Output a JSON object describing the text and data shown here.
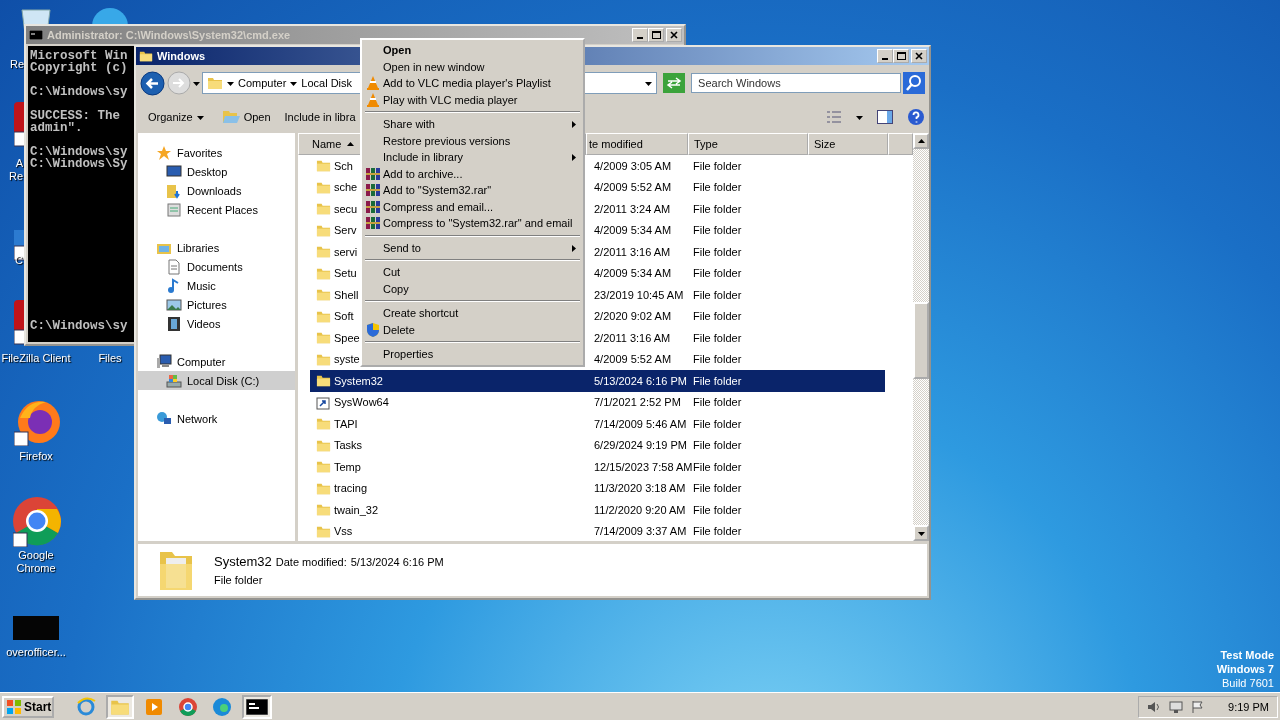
{
  "desktop_icons": [
    {
      "kind": "recycle-bin",
      "lines": [
        "Re"
      ]
    },
    {
      "kind": "blue-app"
    },
    {
      "kind": "red-app",
      "lines": [
        "A",
        "Re"
      ]
    },
    {
      "kind": "blue-shortcut",
      "lines": [
        "C"
      ]
    },
    {
      "kind": "red-app",
      "lines": [
        "FileZilla Client"
      ]
    },
    {
      "lines": [
        "Files"
      ]
    },
    {
      "kind": "firefox",
      "lines": [
        "Firefox"
      ]
    },
    {
      "kind": "chrome",
      "lines": [
        "Google",
        "Chrome"
      ]
    },
    {
      "kind": "black-file",
      "lines": [
        "overofficer..."
      ]
    }
  ],
  "cmd_window": {
    "title": "Administrator: C:\\Windows\\System32\\cmd.exe",
    "active": false,
    "output": [
      {
        "text": "Microsoft Win",
        "gap_before": false
      },
      {
        "text": "Copyright (c)",
        "gap_before": false
      },
      {
        "text": "C:\\Windows\\sy",
        "gap_before": true
      },
      {
        "text": "SUCCESS: The",
        "gap_before": true
      },
      {
        "text": "admin\".",
        "gap_before": false
      },
      {
        "text": "C:\\Windows\\sy",
        "gap_before": true
      },
      {
        "text": "C:\\Windows\\Sy",
        "gap_before": false
      }
    ],
    "bottom_line": "C:\\Windows\\sy"
  },
  "explorer": {
    "title": "Windows",
    "active": true,
    "breadcrumb": [
      "Computer",
      "Local Disk"
    ],
    "search": {
      "placeholder": "Search Windows"
    },
    "toolbar": {
      "organize": "Organize",
      "open": "Open",
      "include": "Include in libra"
    },
    "nav": [
      {
        "label": "Favorites",
        "kind": "favorites",
        "selected": false,
        "children": [
          {
            "label": "Desktop",
            "kind": "desktop",
            "selected": false
          },
          {
            "label": "Downloads",
            "kind": "downloads",
            "selected": false
          },
          {
            "label": "Recent Places",
            "kind": "recent",
            "selected": false
          }
        ]
      },
      {
        "label": "Libraries",
        "kind": "libraries",
        "selected": false,
        "children": [
          {
            "label": "Documents",
            "kind": "documents",
            "selected": false
          },
          {
            "label": "Music",
            "kind": "music",
            "selected": false
          },
          {
            "label": "Pictures",
            "kind": "pictures",
            "selected": false
          },
          {
            "label": "Videos",
            "kind": "videos",
            "selected": false
          }
        ]
      },
      {
        "label": "Computer",
        "kind": "computer",
        "selected": false,
        "children": [
          {
            "label": "Local Disk (C:)",
            "kind": "disk",
            "selected": true
          }
        ]
      },
      {
        "label": "Network",
        "kind": "network",
        "selected": false
      }
    ],
    "columns": [
      {
        "label": "Name",
        "sorted": true
      },
      {
        "label": "te modified",
        "sorted": false
      },
      {
        "label": "Type",
        "sorted": false
      },
      {
        "label": "Size",
        "sorted": false
      }
    ],
    "rows": [
      {
        "name": "Sch",
        "date": "4/2009 3:05 AM",
        "type": "File folder",
        "kind": "folder",
        "selected": false
      },
      {
        "name": "sche",
        "date": "4/2009 5:52 AM",
        "type": "File folder",
        "kind": "folder",
        "selected": false
      },
      {
        "name": "secu",
        "date": "2/2011 3:24 AM",
        "type": "File folder",
        "kind": "folder",
        "selected": false
      },
      {
        "name": "Serv",
        "date": "4/2009 5:34 AM",
        "type": "File folder",
        "kind": "folder",
        "selected": false
      },
      {
        "name": "servi",
        "date": "2/2011 3:16 AM",
        "type": "File folder",
        "kind": "folder",
        "selected": false
      },
      {
        "name": "Setu",
        "date": "4/2009 5:34 AM",
        "type": "File folder",
        "kind": "folder",
        "selected": false
      },
      {
        "name": "Shell",
        "date": "23/2019 10:45 AM",
        "type": "File folder",
        "kind": "folder",
        "selected": false
      },
      {
        "name": "Soft",
        "date": "2/2020 9:02 AM",
        "type": "File folder",
        "kind": "folder",
        "selected": false
      },
      {
        "name": "Spee",
        "date": "2/2011 3:16 AM",
        "type": "File folder",
        "kind": "folder",
        "selected": false
      },
      {
        "name": "syste",
        "date": "4/2009 5:52 AM",
        "type": "File folder",
        "kind": "folder",
        "selected": false
      },
      {
        "name": "System32",
        "date": "5/13/2024 6:16 PM",
        "type": "File folder",
        "kind": "folder",
        "selected": true
      },
      {
        "name": "SysWow64",
        "date": "7/1/2021 2:52 PM",
        "type": "File folder",
        "kind": "shortcut",
        "selected": false
      },
      {
        "name": "TAPI",
        "date": "7/14/2009 5:46 AM",
        "type": "File folder",
        "kind": "folder",
        "selected": false
      },
      {
        "name": "Tasks",
        "date": "6/29/2024 9:19 PM",
        "type": "File folder",
        "kind": "folder",
        "selected": false
      },
      {
        "name": "Temp",
        "date": "12/15/2023 7:58 AM",
        "type": "File folder",
        "kind": "folder",
        "selected": false
      },
      {
        "name": "tracing",
        "date": "11/3/2020 3:18 AM",
        "type": "File folder",
        "kind": "folder",
        "selected": false
      },
      {
        "name": "twain_32",
        "date": "11/2/2020 9:20 AM",
        "type": "File folder",
        "kind": "folder",
        "selected": false
      },
      {
        "name": "Vss",
        "date": "7/14/2009 3:37 AM",
        "type": "File folder",
        "kind": "folder",
        "selected": false
      }
    ],
    "details": {
      "name": "System32",
      "date_label": "Date modified:",
      "date": "5/13/2024 6:16 PM",
      "type": "File folder"
    }
  },
  "context_menu": [
    {
      "kind": "plain",
      "label": "Open",
      "default": true,
      "submenu": false
    },
    {
      "kind": "plain",
      "label": "Open in new window",
      "default": false,
      "submenu": false
    },
    {
      "kind": "vlc",
      "label": "Add to VLC media player's Playlist",
      "default": false,
      "submenu": false
    },
    {
      "kind": "vlc",
      "label": "Play with VLC media player",
      "default": false,
      "submenu": false
    },
    {
      "kind": "separator"
    },
    {
      "kind": "plain",
      "label": "Share with",
      "default": false,
      "submenu": true
    },
    {
      "kind": "plain",
      "label": "Restore previous versions",
      "default": false,
      "submenu": false
    },
    {
      "kind": "plain",
      "label": "Include in library",
      "default": false,
      "submenu": true
    },
    {
      "kind": "archive",
      "label": "Add to archive...",
      "default": false,
      "submenu": false
    },
    {
      "kind": "archive",
      "label": "Add to \"System32.rar\"",
      "default": false,
      "submenu": false
    },
    {
      "kind": "archive",
      "label": "Compress and email...",
      "default": false,
      "submenu": false
    },
    {
      "kind": "archive",
      "label": "Compress to \"System32.rar\" and email",
      "default": false,
      "submenu": false
    },
    {
      "kind": "separator"
    },
    {
      "kind": "plain",
      "label": "Send to",
      "default": false,
      "submenu": true
    },
    {
      "kind": "separator"
    },
    {
      "kind": "plain",
      "label": "Cut",
      "default": false,
      "submenu": false
    },
    {
      "kind": "plain",
      "label": "Copy",
      "default": false,
      "submenu": false
    },
    {
      "kind": "separator"
    },
    {
      "kind": "plain",
      "label": "Create shortcut",
      "default": false,
      "submenu": false
    },
    {
      "kind": "shield",
      "label": "Delete",
      "default": false,
      "submenu": false
    },
    {
      "kind": "separator"
    },
    {
      "kind": "plain",
      "label": "Properties",
      "default": false,
      "submenu": false
    }
  ],
  "watermark_system": [
    "Test Mode",
    "Windows 7",
    "Build 7601"
  ],
  "taskbar": {
    "start": "Start",
    "apps": [
      {
        "kind": "ie",
        "selected": false
      },
      {
        "kind": "explorer",
        "selected": true
      },
      {
        "kind": "media",
        "selected": false
      },
      {
        "kind": "chrome",
        "selected": false
      },
      {
        "kind": "edge",
        "selected": false
      },
      {
        "kind": "cmd",
        "selected": true
      }
    ],
    "clock": "9:19 PM"
  }
}
